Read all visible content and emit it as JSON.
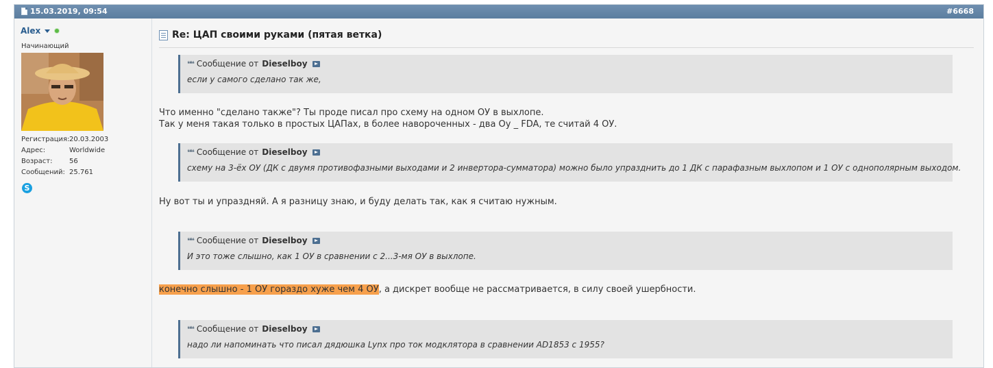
{
  "post": {
    "date": "15.03.2019, 09:54",
    "number": "#6668",
    "title": "Re: ЦАП своими руками (пятая ветка)"
  },
  "user": {
    "name": "Alex",
    "title": "Начинающий",
    "stats": [
      {
        "label": "Регистрация:",
        "value": "20.03.2003"
      },
      {
        "label": "Адрес:",
        "value": "Worldwide"
      },
      {
        "label": "Возраст:",
        "value": "56"
      },
      {
        "label": "Сообщений:",
        "value": "25.761"
      }
    ],
    "online_color": "#5dbb46",
    "skype_icon_letter": "S"
  },
  "quote_prefix": "Сообщение от",
  "quotes": [
    {
      "author": "Dieselboy",
      "text": "если у самого сделано так же,"
    },
    {
      "author": "Dieselboy",
      "text": "схему на 3-ёх ОУ (ДК с двумя противофазными выходами и 2 инвертора-сумматора) можно было упразднить до 1 ДК с парафазным выхлопом и 1 ОУ с однополярным выходом."
    },
    {
      "author": "Dieselboy",
      "text": "И это тоже слышно, как 1 ОУ в сравнении с 2...3-мя ОУ в выхлопе."
    },
    {
      "author": "Dieselboy",
      "text": "надо ли напоминать что писал дядюшка Lynx про ток модклятора в сравнении AD1853 с 1955?"
    }
  ],
  "replies": {
    "r1_line1": "Что именно \"сделано также\"? Ты проде писал про схему на одном ОУ в выхлопе.",
    "r1_line2": "Так у меня такая только в простых ЦАПах, в более навороченных - два Оу _ FDA, те считай 4 ОУ.",
    "r2": "Ну вот ты и упраздняй. А я разницу знаю, и буду делать так, как я считаю нужным.",
    "r3_highlight": "конечно слышно - 1 ОУ гораздо хуже чем 4 ОУ",
    "r3_rest": ", а дискрет вообще не рассматривается, в силу своей ушербности."
  },
  "colors": {
    "header_bar": "#5c7e9f",
    "quote_border": "#4d6f91",
    "highlight": "#f7a04c",
    "username": "#2a5d8f"
  }
}
